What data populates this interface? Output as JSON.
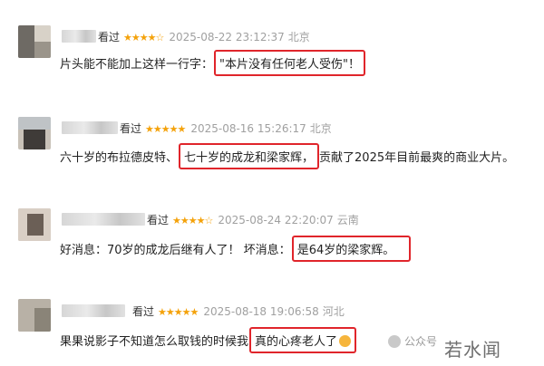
{
  "reviews": [
    {
      "seen": "看过",
      "stars": "★★★★☆",
      "rating": 4,
      "date": "2025-08-22 23:12:37",
      "location": "北京",
      "text_before": "片头能不能加上这样一行字：",
      "highlight": "\"本片没有任何老人受伤\"",
      "text_after": "！"
    },
    {
      "seen": "看过",
      "stars": "★★★★★",
      "rating": 5,
      "date": "2025-08-16 15:26:17",
      "location": "北京",
      "text_before": "六十岁的布拉德皮特、",
      "highlight": "七十岁的成龙和梁家辉，",
      "text_after": "贡献了2025年目前最爽的商业大片。"
    },
    {
      "seen": "看过",
      "stars": "★★★★☆",
      "rating": 4,
      "date": "2025-08-24 22:20:07",
      "location": "云南",
      "text_before": "好消息：70岁的成龙后继有人了！ 坏消息：",
      "highlight": "是64岁的梁家辉。",
      "text_after": ""
    },
    {
      "seen": "看过",
      "stars": "★★★★★",
      "rating": 5,
      "date": "2025-08-18 19:06:58",
      "location": "河北",
      "text_before": "果果说影子不知道怎么取钱的时候我",
      "highlight": "真的心疼老人了",
      "text_after": ""
    }
  ],
  "watermark": {
    "small": "公众号",
    "large": "若水闻"
  },
  "colors": {
    "highlight_border": "#e0252b",
    "star": "#f4a20b",
    "meta": "#a0a0a0"
  },
  "icons": {
    "emoji": "crying-face-icon",
    "wechat": "wechat-icon"
  }
}
